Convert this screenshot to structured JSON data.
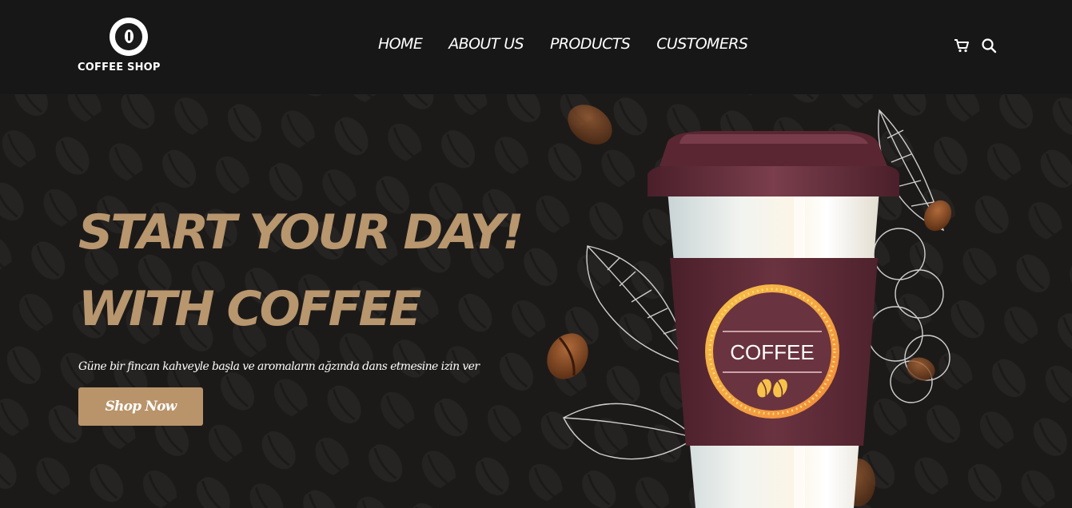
{
  "brand": {
    "name": "COFFEE SHOP"
  },
  "nav": {
    "items": [
      "HOME",
      "ABOUT US",
      "PRODUCTS",
      "CUSTOMERS"
    ]
  },
  "header_icons": [
    "cart-icon",
    "search-icon"
  ],
  "hero": {
    "headline_line1": "START YOUR DAY!",
    "headline_line2": "WITH COFFEE",
    "subtitle": "Güne bir fincan kahveyle başla ve aromaların ağzında dans etmesine izin ver",
    "cta_label": "Shop Now",
    "cup_label": "COFFEE"
  },
  "colors": {
    "background": "#171717",
    "accent": "#b8966e",
    "cup_sleeve": "#5e2a36"
  }
}
